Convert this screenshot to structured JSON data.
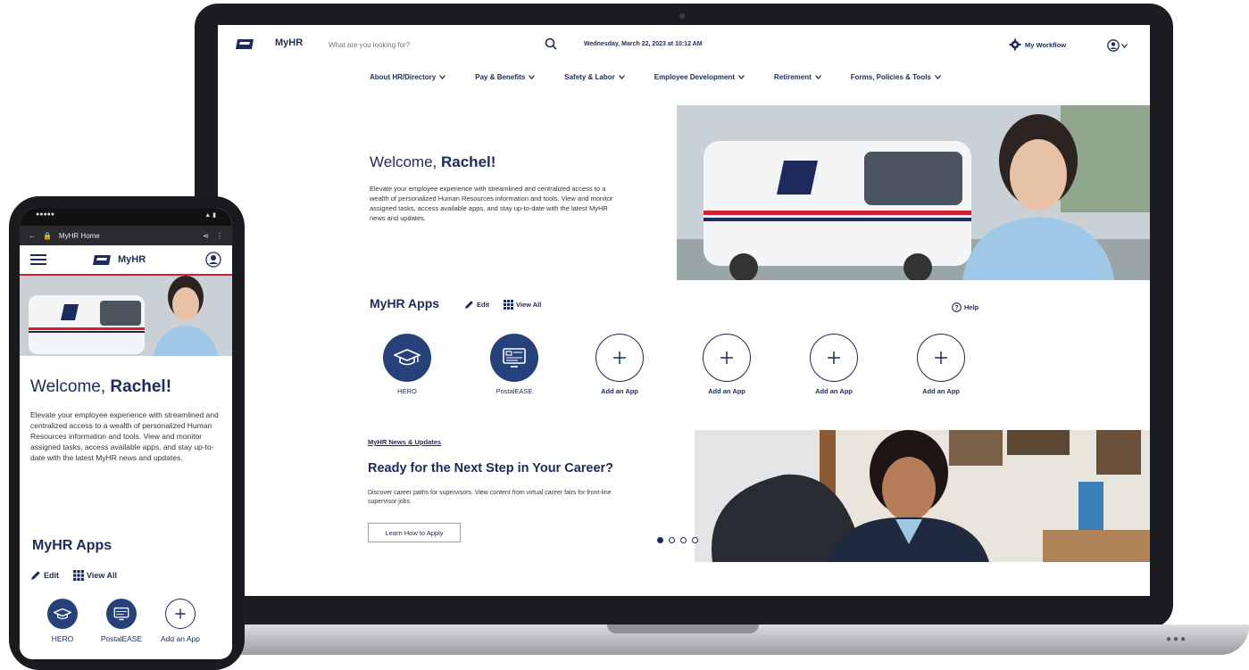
{
  "desktop": {
    "brand": "MyHR",
    "search": {
      "placeholder": "What are you looking for?"
    },
    "datetime": "Wednesday, March 22, 2023 at 10:12 AM",
    "workflow_label": "My Workflow",
    "nav": [
      {
        "label": "About HR/Directory"
      },
      {
        "label": "Pay & Benefits"
      },
      {
        "label": "Safety & Labor"
      },
      {
        "label": "Employee Development"
      },
      {
        "label": "Retirement"
      },
      {
        "label": "Forms, Policies & Tools"
      }
    ],
    "welcome": {
      "prefix": "Welcome, ",
      "name": "Rachel!"
    },
    "welcome_text": "Elevate your employee experience with streamlined and centralized access to a wealth of personalized Human Resources information and tools. View and monitor assigned tasks, access available apps, and stay up-to-date with the latest MyHR news and updates.",
    "apps_section": {
      "title": "MyHR Apps",
      "edit_label": "Edit",
      "view_all_label": "View All",
      "help_label": "Help",
      "apps": [
        {
          "label": "HERO",
          "icon": "graduation-cap-icon"
        },
        {
          "label": "PostalEASE",
          "icon": "monitor-form-icon"
        },
        {
          "label": "Add an App",
          "icon": "plus-icon"
        },
        {
          "label": "Add an App",
          "icon": "plus-icon"
        },
        {
          "label": "Add an App",
          "icon": "plus-icon"
        },
        {
          "label": "Add an App",
          "icon": "plus-icon"
        }
      ]
    },
    "news": {
      "link": "MyHR News & Updates",
      "title": "Ready for the Next Step in Your Career?",
      "text": "Discover career paths for supervisors. View content from virtual career fairs for front-line supervisor jobs",
      "button": "Learn How to Apply",
      "carousel": {
        "total": 4,
        "active": 1
      }
    }
  },
  "mobile": {
    "url_title": "MyHR Home",
    "brand": "MyHR",
    "welcome": {
      "prefix": "Welcome, ",
      "name": "Rachel!"
    },
    "welcome_text": "Elevate your employee experience with streamlined and centralized access to a wealth of personalized Human Resources information and tools. View and monitor assigned tasks, access available apps, and stay up-to-date with the latest MyHR news and updates.",
    "apps_title": "MyHR Apps",
    "edit_label": "Edit",
    "view_all_label": "View All",
    "apps": [
      {
        "label": "HERO",
        "icon": "graduation-cap-icon"
      },
      {
        "label": "PostalEASE",
        "icon": "monitor-form-icon"
      },
      {
        "label": "Add an App",
        "icon": "plus-icon"
      }
    ]
  },
  "colors": {
    "navy": "#1d2a5b",
    "app_fill": "#27427a",
    "accent_red": "#d32031"
  }
}
